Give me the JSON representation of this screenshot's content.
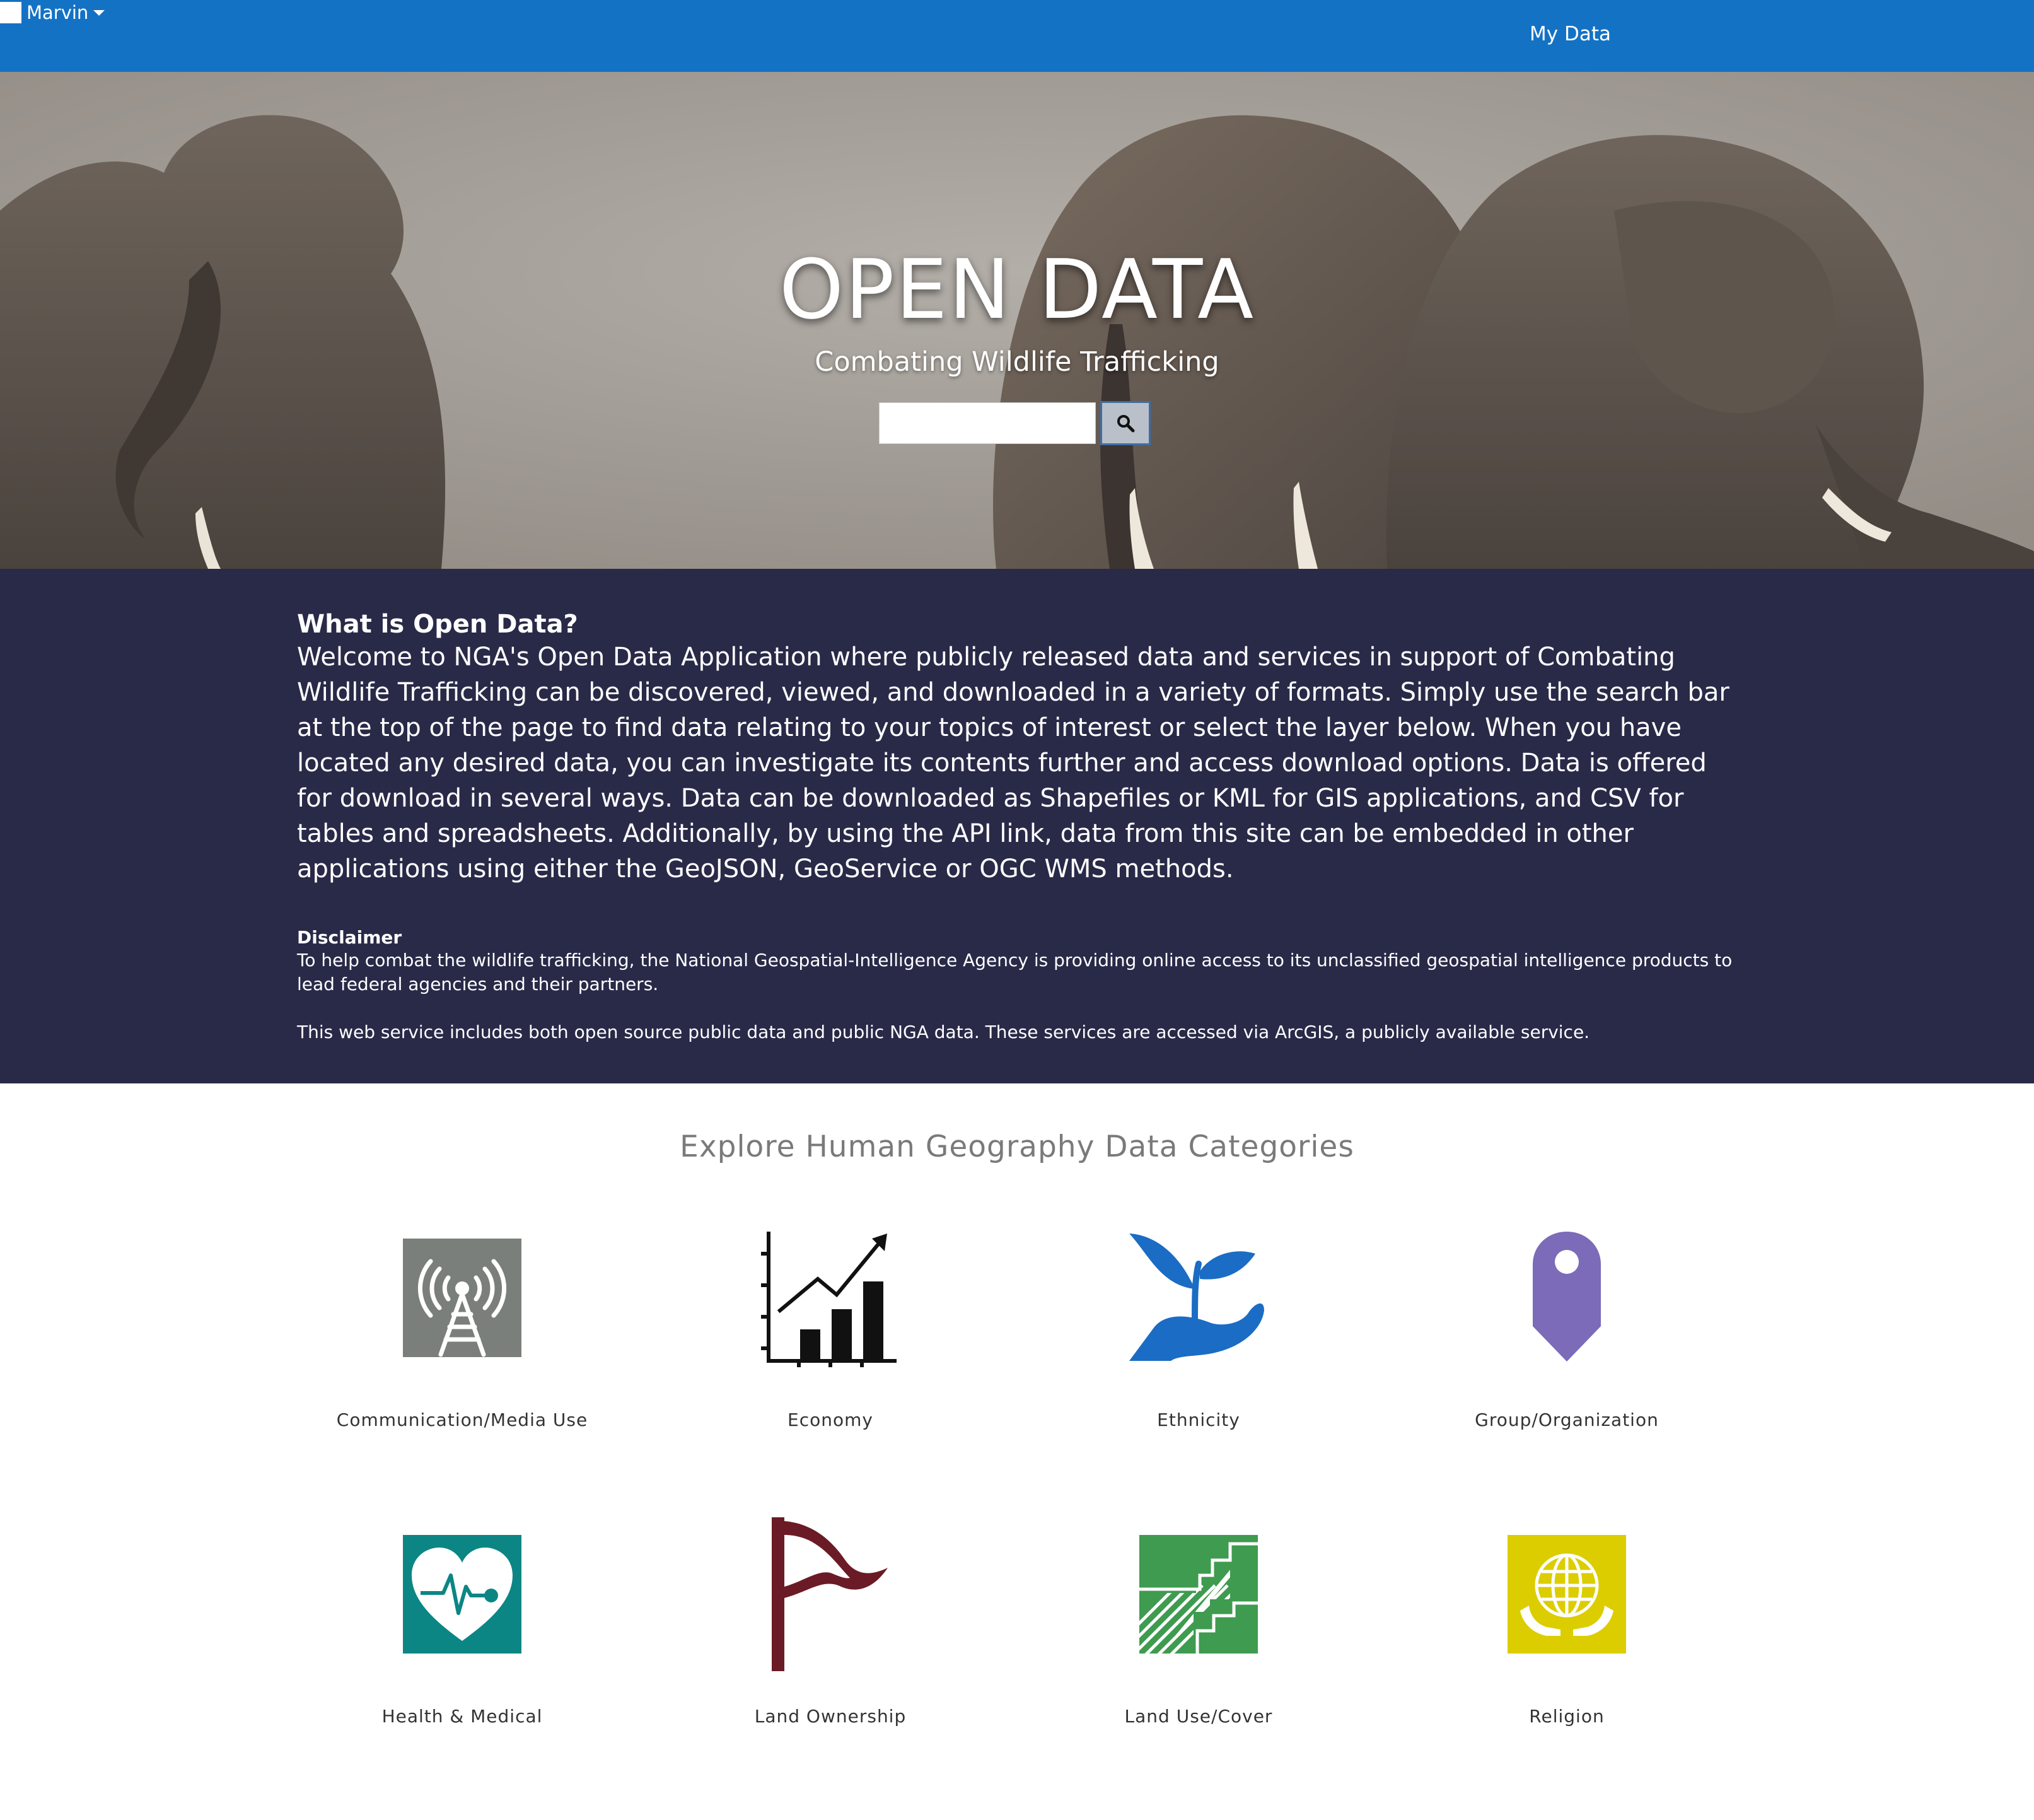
{
  "nav": {
    "my_data": "My Data",
    "user": "Marvin"
  },
  "hero": {
    "title": "OPEN DATA",
    "subtitle": "Combating Wildlife Trafficking",
    "search_value": "",
    "search_icon": "search-icon"
  },
  "info": {
    "heading": "What is Open Data?",
    "body": "Welcome to NGA's Open Data Application where publicly released data and services in support of Combating Wildlife Trafficking can be discovered, viewed, and downloaded in a variety of formats. Simply use the search bar at the top of the page to find data relating to your topics of interest or select the layer below. When you have located any desired data, you can investigate its contents further and access download options. Data is offered for download in several ways. Data can be downloaded as Shapefiles or KML for GIS applications, and CSV for tables and spreadsheets. Additionally, by using the API link, data from this site can be embedded in other applications using either the GeoJSON, GeoService or OGC WMS methods.",
    "disclaimer_heading": "Disclaimer",
    "disclaimer_body": "To help combat the wildlife trafficking, the National Geospatial-Intelligence Agency is providing online access to its unclassified geospatial intelligence products to lead federal agencies and their partners.",
    "disclaimer_body2": "This web service includes both open source public data and public NGA data. These services are accessed via ArcGIS, a publicly available service."
  },
  "categories": {
    "title": "Explore Human Geography Data Categories",
    "items": [
      {
        "label": "Communication/Media Use",
        "icon": "radio-tower-icon",
        "color": "#7b7f7b"
      },
      {
        "label": "Economy",
        "icon": "growth-chart-icon",
        "color": "#111111"
      },
      {
        "label": "Ethnicity",
        "icon": "hand-sprout-icon",
        "color": "#1b6cc4"
      },
      {
        "label": "Group/Organization",
        "icon": "map-pin-icon",
        "color": "#7b6bb8"
      },
      {
        "label": "Health & Medical",
        "icon": "heart-pulse-icon",
        "color": "#0b8685"
      },
      {
        "label": "Land Ownership",
        "icon": "flag-icon",
        "color": "#6b1b25"
      },
      {
        "label": "Land Use/Cover",
        "icon": "land-parcel-icon",
        "color": "#3e9b4f"
      },
      {
        "label": "Religion",
        "icon": "globe-hands-icon",
        "color": "#dccd00"
      }
    ]
  },
  "colors": {
    "nav_bar": "#1472c4",
    "info_band": "#292a48"
  }
}
